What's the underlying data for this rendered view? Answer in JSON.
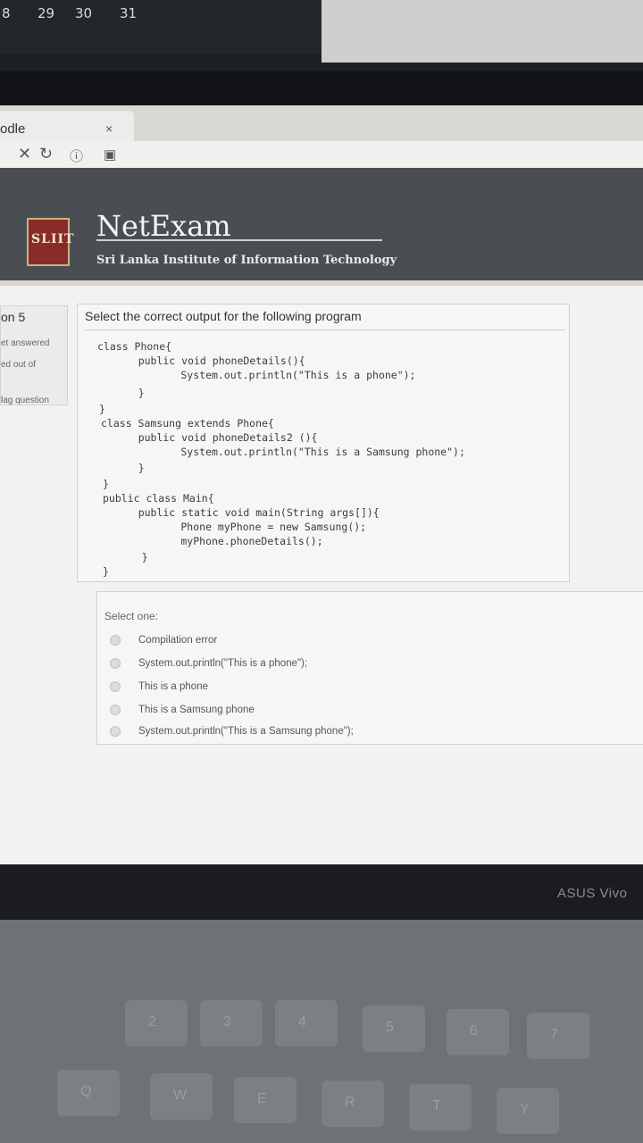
{
  "calendar": {
    "days": [
      "8",
      "29",
      "30",
      "31"
    ]
  },
  "browser": {
    "tab_title": "odle",
    "tab_close": "×",
    "nav_icons": [
      "close-icon",
      "reload-icon",
      "info-icon",
      "page-icon"
    ]
  },
  "header": {
    "logo_text": "SLIIT",
    "title": "NetExam",
    "subtitle": "Sri Lanka Institute of Information Technology"
  },
  "question_info": {
    "number_label": "on 5",
    "status": "et answered",
    "marks": "ed out of",
    "flag": "lag question"
  },
  "question": {
    "text": "Select the correct output for the following program",
    "code": [
      "class Phone{",
      "    public void phoneDetails(){",
      "        System.out.println(\"This is a phone\");",
      "    }",
      "}",
      "class Samsung extends Phone{",
      "    public void phoneDetails2 (){",
      "        System.out.println(\"This is a Samsung phone\");",
      "    }",
      "}",
      "public class Main{",
      "    public static void main(String args[]){",
      "        Phone myPhone = new Samsung();",
      "        myPhone.phoneDetails();",
      "    }",
      "}"
    ]
  },
  "answer": {
    "select_label": "Select one:",
    "options": [
      "Compilation error",
      "System.out.println(\"This is a phone\");",
      "This is a phone",
      "This is a Samsung phone",
      "System.out.println(\"This is a Samsung phone\");"
    ]
  },
  "device": {
    "brand": "ASUS Vivo"
  },
  "keyboard": {
    "keys": [
      "2",
      "3",
      "4",
      "5",
      "6",
      "7",
      "Q",
      "W",
      "E",
      "R",
      "T",
      "Y"
    ]
  },
  "colors": {
    "banner": "#4a4d52",
    "logo": "#8a2b2b",
    "page": "#f2f2f0"
  }
}
